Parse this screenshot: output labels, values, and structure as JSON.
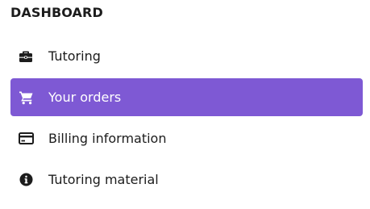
{
  "sidebar": {
    "section_title": "DASHBOARD",
    "items": [
      {
        "label": "Tutoring",
        "icon": "briefcase-icon",
        "active": false
      },
      {
        "label": "Your orders",
        "icon": "shopping-cart-icon",
        "active": true
      },
      {
        "label": "Billing information",
        "icon": "credit-card-icon",
        "active": false
      },
      {
        "label": "Tutoring material",
        "icon": "info-icon",
        "active": false
      }
    ]
  },
  "colors": {
    "accent": "#7e59d4",
    "text": "#1c1c1c",
    "active_text": "#ffffff",
    "background": "#ffffff"
  }
}
